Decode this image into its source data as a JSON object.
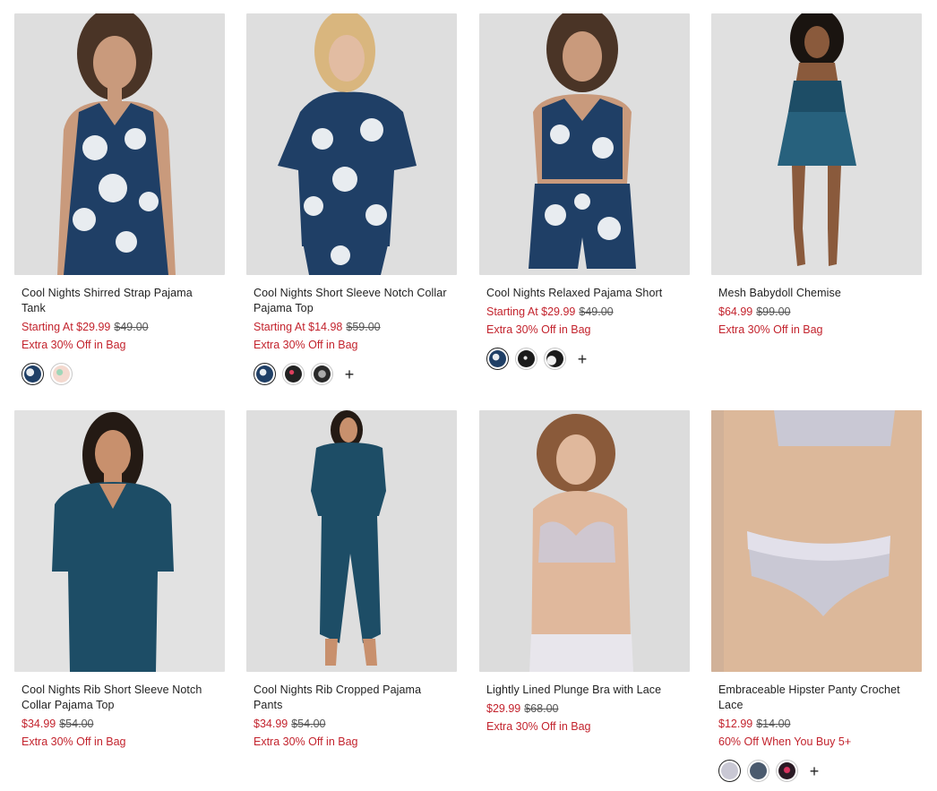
{
  "products": [
    {
      "name": "Cool Nights Shirred Strap Pajama Tank",
      "sale_price": "Starting At $29.99",
      "original_price": "$49.00",
      "promo": "Extra 30% Off in Bag",
      "photo_icon": "model-floral-navy-tank-image",
      "swatches": [
        "navy-floral",
        "peach-floral"
      ],
      "more_colors": ""
    },
    {
      "name": "Cool Nights Short Sleeve Notch Collar Pajama Top",
      "sale_price": "Starting At $14.98",
      "original_price": "$59.00",
      "promo": "Extra 30% Off in Bag",
      "photo_icon": "model-floral-navy-top-image",
      "swatches": [
        "navy-floral",
        "black-dot",
        "black-floral"
      ],
      "more_colors": "+"
    },
    {
      "name": "Cool Nights Relaxed Pajama Short",
      "sale_price": "Starting At $29.99",
      "original_price": "$49.00",
      "promo": "Extra 30% Off in Bag",
      "photo_icon": "model-floral-navy-short-image",
      "swatches": [
        "navy-floral",
        "black-print",
        "black-white"
      ],
      "more_colors": "+"
    },
    {
      "name": "Mesh Babydoll Chemise",
      "sale_price": "$64.99",
      "original_price": "$99.00",
      "promo": "Extra 30% Off in Bag",
      "photo_icon": "model-teal-chemise-image",
      "swatches": [],
      "more_colors": ""
    },
    {
      "name": "Cool Nights Rib Short Sleeve Notch Collar Pajama Top",
      "sale_price": "$34.99",
      "original_price": "$54.00",
      "promo": "Extra 30% Off in Bag",
      "photo_icon": "model-teal-rib-top-image",
      "swatches": [],
      "more_colors": ""
    },
    {
      "name": "Cool Nights Rib Cropped Pajama Pants",
      "sale_price": "$34.99",
      "original_price": "$54.00",
      "promo": "Extra 30% Off in Bag",
      "photo_icon": "model-teal-rib-pants-image",
      "swatches": [],
      "more_colors": ""
    },
    {
      "name": "Lightly Lined Plunge Bra with Lace",
      "sale_price": "$29.99",
      "original_price": "$68.00",
      "promo": "Extra 30% Off in Bag",
      "photo_icon": "model-lilac-bra-image",
      "swatches": [],
      "more_colors": ""
    },
    {
      "name": "Embraceable Hipster Panty Crochet Lace",
      "sale_price": "$12.99",
      "original_price": "$14.00",
      "promo": "60% Off When You Buy 5+",
      "photo_icon": "model-lilac-panty-image",
      "swatches": [
        "lilac-grey",
        "slate-blue",
        "black-pink-print"
      ],
      "more_colors": "+"
    }
  ],
  "colors": {
    "sale_red": "#c3232d",
    "navy": "#1f3f66",
    "teal": "#1d4d66",
    "lilac": "#c9c8d4",
    "photo_bg": "#dcdcdc"
  }
}
